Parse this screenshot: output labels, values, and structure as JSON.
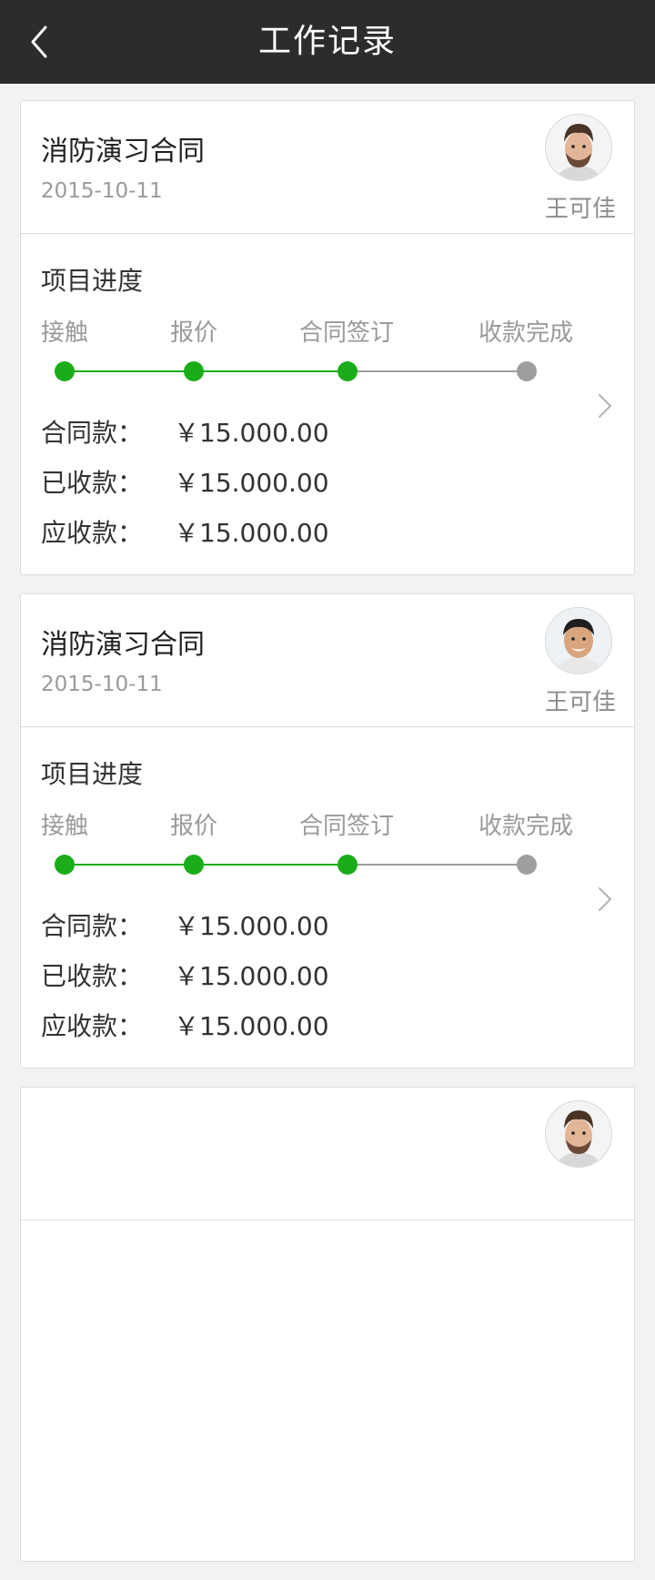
{
  "header": {
    "title": "工作记录",
    "back_icon": "chevron-left-icon"
  },
  "colors": {
    "header_bg": "#2c2c2e",
    "done": "#1aad19",
    "pending": "#9e9e9e"
  },
  "records": [
    {
      "title": "消防演习合同",
      "date": "2015-10-11",
      "owner": "王可佳",
      "avatar": "avatar-man-beard",
      "progress_title": "项目进度",
      "stages": [
        "接触",
        "报价",
        "合同签订",
        "收款完成"
      ],
      "completed_stages": 3,
      "amounts": [
        {
          "label": "合同款：",
          "value": "￥15.000.00"
        },
        {
          "label": "已收款：",
          "value": "￥15.000.00"
        },
        {
          "label": "应收款：",
          "value": "￥15.000.00"
        }
      ]
    },
    {
      "title": "消防演习合同",
      "date": "2015-10-11",
      "owner": "王可佳",
      "avatar": "avatar-man-smiling",
      "progress_title": "项目进度",
      "stages": [
        "接触",
        "报价",
        "合同签订",
        "收款完成"
      ],
      "completed_stages": 3,
      "amounts": [
        {
          "label": "合同款：",
          "value": "￥15.000.00"
        },
        {
          "label": "已收款：",
          "value": "￥15.000.00"
        },
        {
          "label": "应收款：",
          "value": "￥15.000.00"
        }
      ]
    },
    {
      "title": "",
      "date": "",
      "owner": "",
      "avatar": "avatar-man-beard",
      "progress_title": "",
      "stages": [],
      "completed_stages": 0,
      "amounts": []
    }
  ]
}
